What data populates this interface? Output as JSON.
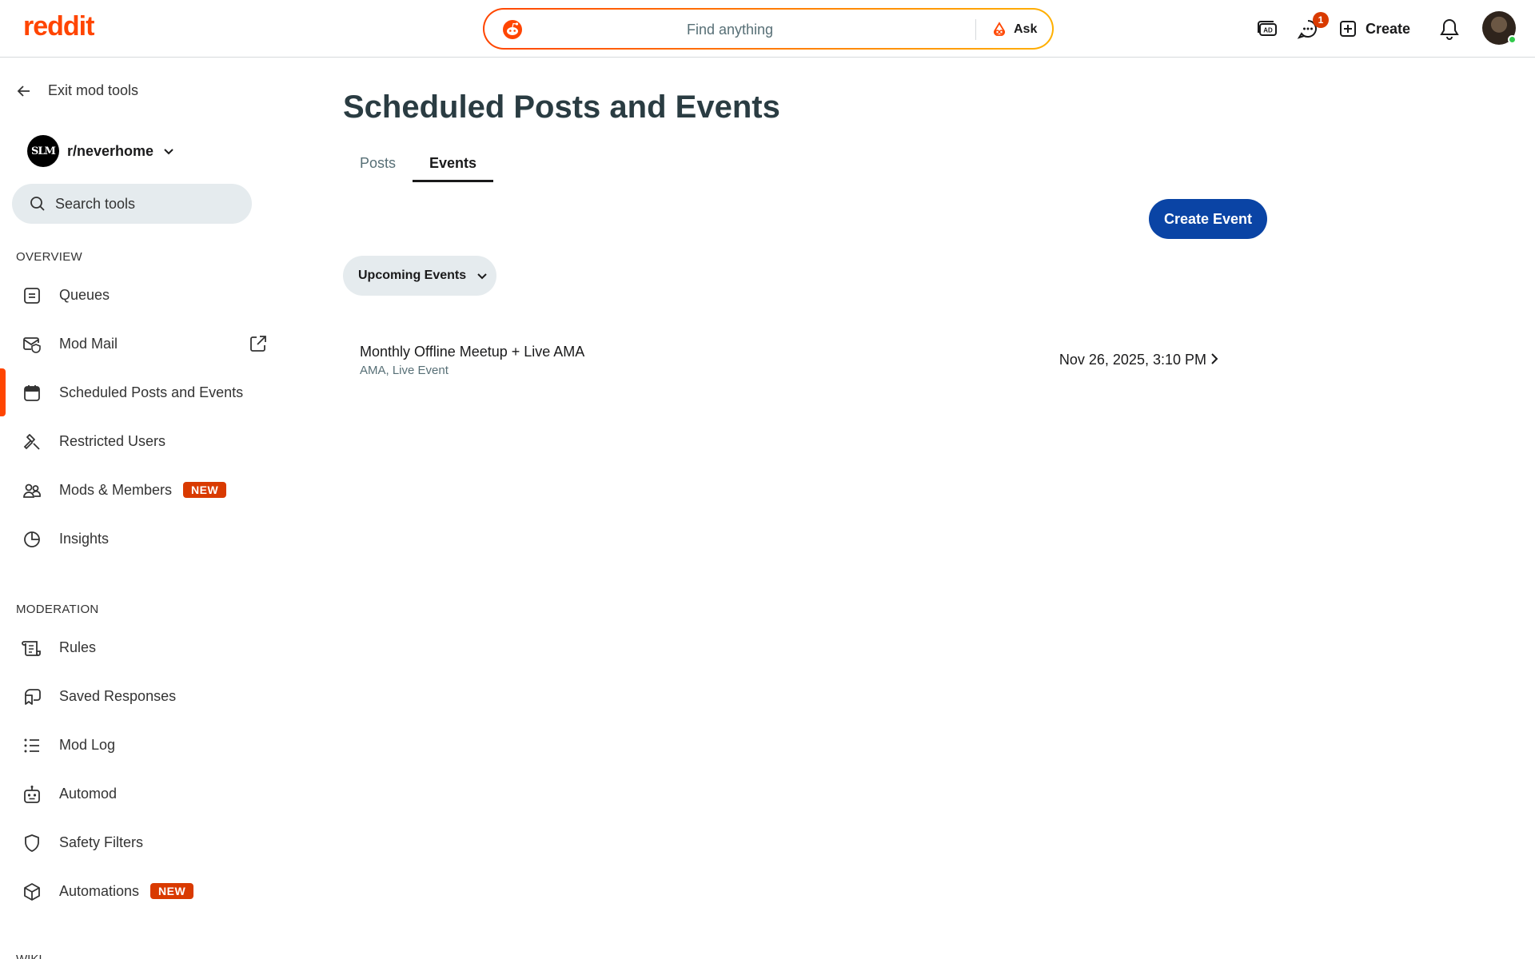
{
  "header": {
    "logo": "reddit",
    "search_placeholder": "Find anything",
    "ask_label": "Ask",
    "chat_badge": "1",
    "create_label": "Create"
  },
  "sidebar": {
    "exit_label": "Exit mod tools",
    "community_name": "r/neverhome",
    "community_avatar_text": "SLM",
    "search_placeholder": "Search tools",
    "overview_label": "OVERVIEW",
    "overview_items": [
      {
        "label": "Queues",
        "icon": "queue-icon"
      },
      {
        "label": "Mod Mail",
        "icon": "mod-mail-icon"
      },
      {
        "label": "Scheduled Posts and Events",
        "icon": "calendar-icon"
      },
      {
        "label": "Restricted Users",
        "icon": "hammer-icon"
      },
      {
        "label": "Mods & Members",
        "icon": "members-icon",
        "badge": "NEW"
      },
      {
        "label": "Insights",
        "icon": "pie-chart-icon"
      }
    ],
    "moderation_label": "MODERATION",
    "moderation_items": [
      {
        "label": "Rules",
        "icon": "scroll-icon"
      },
      {
        "label": "Saved Responses",
        "icon": "saved-response-icon"
      },
      {
        "label": "Mod Log",
        "icon": "list-icon"
      },
      {
        "label": "Automod",
        "icon": "robot-icon"
      },
      {
        "label": "Safety Filters",
        "icon": "shield-icon"
      },
      {
        "label": "Automations",
        "icon": "cube-icon",
        "badge": "NEW"
      }
    ],
    "wiki_label_partial": "WIKI"
  },
  "main": {
    "title": "Scheduled Posts and Events",
    "tabs": [
      {
        "label": "Posts",
        "active": false
      },
      {
        "label": "Events",
        "active": true
      }
    ],
    "create_event_label": "Create Event",
    "filter_label": "Upcoming Events",
    "events": [
      {
        "title": "Monthly Offline Meetup + Live AMA",
        "tags": "AMA, Live Event",
        "date": "Nov 26, 2025, 3:10 PM"
      }
    ]
  },
  "colors": {
    "brand": "#ff4500",
    "primary_button": "#0a44a5",
    "new_badge": "#d93a00"
  }
}
